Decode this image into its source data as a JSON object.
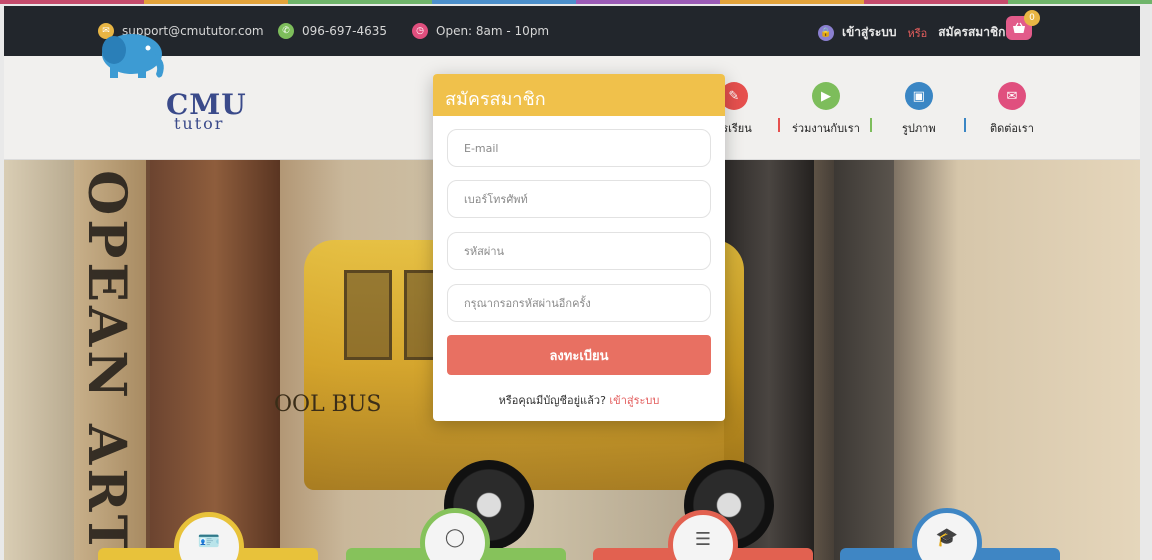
{
  "strip_colors": [
    "#c54b6c",
    "#e3a33b",
    "#6fb46a",
    "#4c8fcb",
    "#9b5bb6",
    "#e3a33b",
    "#c54b6c",
    "#6fb46a"
  ],
  "topbar": {
    "email": "support@cmututor.com",
    "email_icon": "email-icon",
    "phone": "096-697-4635",
    "phone_icon": "phone-icon",
    "hours": "Open: 8am - 10pm",
    "hours_icon": "clock-icon",
    "login_label": "เข้าสู่ระบบ",
    "or_label": "หรือ",
    "register_label": "สมัครสมาชิก",
    "cart_count": "0"
  },
  "logo": {
    "text_main": "CMU",
    "text_sub": "tutor"
  },
  "nav": [
    {
      "label": "ารเรียน",
      "color": "#e6504e",
      "icon": "pencil-icon"
    },
    {
      "label": "ร่วมงานกับเรา",
      "color": "#7dbd5b",
      "icon": "video-icon"
    },
    {
      "label": "รูปภาพ",
      "color": "#3a86c4",
      "icon": "image-icon"
    },
    {
      "label": "ติดต่อเรา",
      "color": "#e04f7e",
      "icon": "mail-icon"
    }
  ],
  "hero": {
    "book_text": "OPEAN ART",
    "bus_text": "OOL BUS"
  },
  "modal": {
    "title": "สมัครสมาชิก",
    "email_placeholder": "E-mail",
    "phone_placeholder": "เบอร์โทรศัพท์",
    "password_placeholder": "รหัสผ่าน",
    "confirm_placeholder": "กรุณากรอกรหัสผ่านอีกครั้ง",
    "submit_label": "ลงทะเบียน",
    "footer_text": "หรือคุณมีบัญชีอยู่แล้ว?",
    "footer_link": "เข้าสู่ระบบ"
  },
  "bottom_cards": [
    {
      "color": "#e8c23a",
      "icon": "id-card-icon"
    },
    {
      "color": "#86c25b",
      "icon": "user-icon"
    },
    {
      "color": "#e26150",
      "icon": "list-icon"
    },
    {
      "color": "#3f86c4",
      "icon": "graduation-cap-icon"
    }
  ]
}
